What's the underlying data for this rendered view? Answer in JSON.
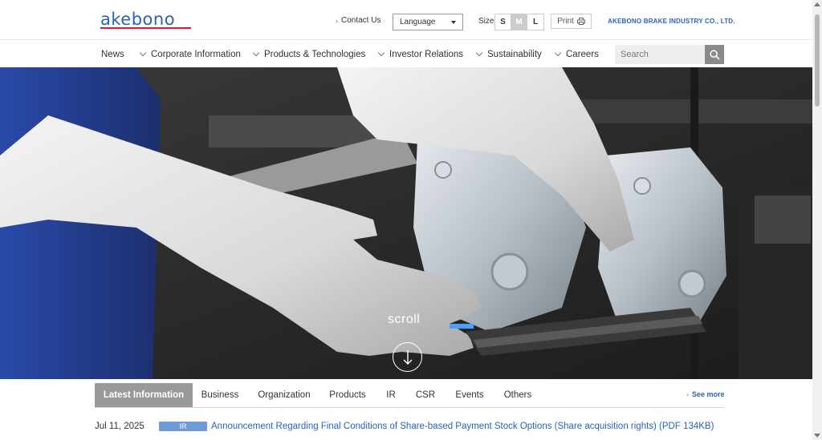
{
  "header": {
    "logo_text": "akebono",
    "contact_label": "Contact Us",
    "language_label": "Language",
    "size_label": "Size",
    "size_options": [
      "S",
      "M",
      "L"
    ],
    "size_selected": "M",
    "print_label": "Print",
    "company_name": "AKEBONO BRAKE INDUSTRY CO., LTD."
  },
  "nav": {
    "items": [
      {
        "label": "News",
        "dropdown": false
      },
      {
        "label": "Corporate Information",
        "dropdown": true
      },
      {
        "label": "Products & Technologies",
        "dropdown": true
      },
      {
        "label": "Investor Relations",
        "dropdown": true
      },
      {
        "label": "Sustainability",
        "dropdown": true
      },
      {
        "label": "Careers",
        "dropdown": true
      }
    ],
    "search_placeholder": "Search"
  },
  "hero": {
    "scroll_label": "scroll"
  },
  "news": {
    "tabs": [
      "Latest Information",
      "Business",
      "Organization",
      "Products",
      "IR",
      "CSR",
      "Events",
      "Others"
    ],
    "active_tab": "Latest Information",
    "see_more_label": "See more",
    "items": [
      {
        "date": "Jul 11, 2025",
        "category": "IR",
        "title": "Announcement Regarding Final Conditions of Share-based Payment Stock Options (Share acquisition rights) (PDF 134KB)"
      }
    ]
  },
  "colors": {
    "brand_blue": "#2a63b8",
    "brand_red": "#d12027",
    "tab_active": "#999999",
    "badge_ir": "#6e9ad6"
  }
}
